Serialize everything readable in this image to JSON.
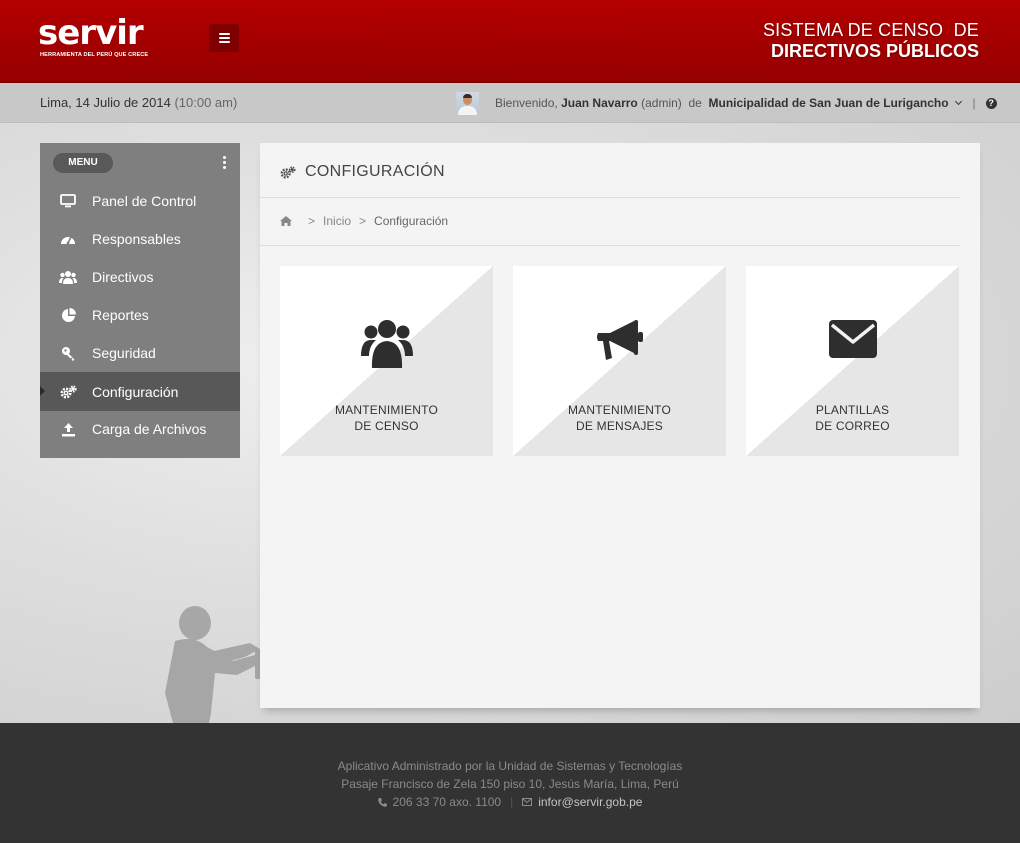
{
  "header": {
    "logo_text": "servir",
    "logo_tagline": "HERRAMIENTA DEL PERÚ QUE CRECE",
    "system_title_line1": "SISTEMA DE CENSO  DE",
    "system_title_line2": "DIRECTIVOS PÚBLICOS",
    "brand_color": "#a80000"
  },
  "subbar": {
    "date": "Lima, 14 Julio de 2014",
    "time": "(10:00 am)",
    "welcome": "Bienvenido,",
    "user_name": "Juan Navarro",
    "user_role": "(admin)",
    "of_label": "de",
    "organization": "Municipalidad de San Juan de Lurigancho",
    "separator": "|",
    "help_symbol": "?"
  },
  "sidebar": {
    "menu_label": "MENU",
    "items": [
      {
        "label": "Panel de Control",
        "icon": "monitor-icon"
      },
      {
        "label": "Responsables",
        "icon": "dashboard-icon"
      },
      {
        "label": "Directivos",
        "icon": "users-icon"
      },
      {
        "label": "Reportes",
        "icon": "pie-chart-icon"
      },
      {
        "label": "Seguridad",
        "icon": "key-icon"
      },
      {
        "label": "Configuración",
        "icon": "gears-icon",
        "active": true
      },
      {
        "label": "Carga de Archivos",
        "icon": "upload-icon"
      }
    ]
  },
  "content": {
    "title": "CONFIGURACIÓN",
    "breadcrumb": {
      "home": "Inicio",
      "current": "Configuración"
    },
    "tiles": [
      {
        "line1": "MANTENIMIENTO",
        "line2": "DE CENSO",
        "icon": "users-icon"
      },
      {
        "line1": "MANTENIMIENTO",
        "line2": "DE MENSAJES",
        "icon": "bullhorn-icon"
      },
      {
        "line1": "PLANTILLAS",
        "line2": "DE CORREO",
        "icon": "envelope-icon"
      }
    ]
  },
  "footer": {
    "line1": "Aplicativo Administrado por la Unidad de Sistemas y Tecnologías",
    "line2": "Pasaje Francisco de Zela 150 piso 10, Jesús María, Lima, Perú",
    "phone": "206 33 70 axo. 1100",
    "separator": "|",
    "email": "infor@servir.gob.pe"
  }
}
